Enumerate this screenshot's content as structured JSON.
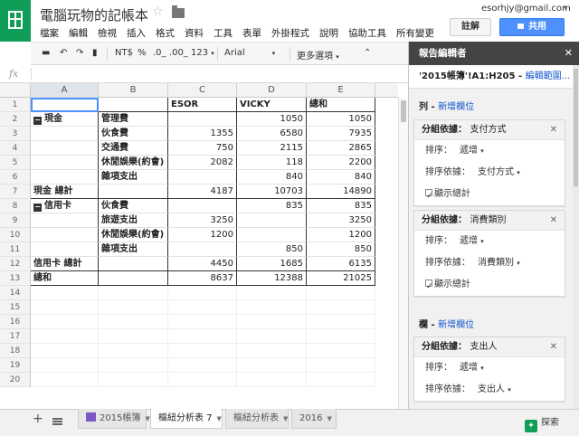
{
  "doc_title": "電腦玩物的記帳本",
  "user_email": "esorhjy@gmail.com",
  "menu": [
    "檔案",
    "編輯",
    "檢視",
    "插入",
    "格式",
    "資料",
    "工具",
    "表單",
    "外掛程式",
    "說明",
    "協助工具",
    "所有變更"
  ],
  "buttons": {
    "comment": "註解",
    "share": "共用"
  },
  "toolbar": {
    "currency": "NT$",
    "percent": "%",
    "dec_less": ".0_",
    "dec_more": ".00_",
    "format123": "123",
    "font": "Arial",
    "more": "更多選項"
  },
  "formula_label": "fx",
  "columns": [
    "A",
    "B",
    "C",
    "D",
    "E"
  ],
  "rows": [
    {
      "n": "1",
      "a": "",
      "b": "",
      "c": "ESOR",
      "d": "VICKY",
      "e": "總和"
    },
    {
      "n": "2",
      "a": "現金",
      "b": "管理費",
      "c": "",
      "d": "1050",
      "e": "1050"
    },
    {
      "n": "3",
      "a": "",
      "b": "伙食費",
      "c": "1355",
      "d": "6580",
      "e": "7935"
    },
    {
      "n": "4",
      "a": "",
      "b": "交通費",
      "c": "750",
      "d": "2115",
      "e": "2865"
    },
    {
      "n": "5",
      "a": "",
      "b": "休閒娛樂(約會)",
      "c": "2082",
      "d": "118",
      "e": "2200"
    },
    {
      "n": "6",
      "a": "",
      "b": "雜項支出",
      "c": "",
      "d": "840",
      "e": "840"
    },
    {
      "n": "7",
      "a": "現金 總計",
      "b": "",
      "c": "4187",
      "d": "10703",
      "e": "14890"
    },
    {
      "n": "8",
      "a": "信用卡",
      "b": "伙食費",
      "c": "",
      "d": "835",
      "e": "835"
    },
    {
      "n": "9",
      "a": "",
      "b": "旅遊支出",
      "c": "3250",
      "d": "",
      "e": "3250"
    },
    {
      "n": "10",
      "a": "",
      "b": "休閒娛樂(約會)",
      "c": "1200",
      "d": "",
      "e": "1200"
    },
    {
      "n": "11",
      "a": "",
      "b": "雜項支出",
      "c": "",
      "d": "850",
      "e": "850"
    },
    {
      "n": "12",
      "a": "信用卡 總計",
      "b": "",
      "c": "4450",
      "d": "1685",
      "e": "6135"
    },
    {
      "n": "13",
      "a": "總和",
      "b": "",
      "c": "8637",
      "d": "12388",
      "e": "21025"
    },
    {
      "n": "14",
      "a": "",
      "b": "",
      "c": "",
      "d": "",
      "e": ""
    },
    {
      "n": "15",
      "a": "",
      "b": "",
      "c": "",
      "d": "",
      "e": ""
    },
    {
      "n": "16",
      "a": "",
      "b": "",
      "c": "",
      "d": "",
      "e": ""
    },
    {
      "n": "17",
      "a": "",
      "b": "",
      "c": "",
      "d": "",
      "e": ""
    },
    {
      "n": "18",
      "a": "",
      "b": "",
      "c": "",
      "d": "",
      "e": ""
    },
    {
      "n": "19",
      "a": "",
      "b": "",
      "c": "",
      "d": "",
      "e": ""
    },
    {
      "n": "20",
      "a": "",
      "b": "",
      "c": "",
      "d": "",
      "e": ""
    }
  ],
  "panel": {
    "title": "報告編輯者",
    "range": "'2015帳簿'!A1:H205",
    "edit_range": "編輯範圍...",
    "rows_section": "列",
    "cols_section": "欄",
    "add_field": "新增欄位",
    "cards_rows": [
      {
        "group": "分組依據：",
        "field": "支付方式",
        "sort_label": "排序：",
        "sort_value": "遞增",
        "sortby_label": "排序依據：",
        "sortby_value": "支付方式",
        "totals": "顯示總計"
      },
      {
        "group": "分組依據：",
        "field": "消費類別",
        "sort_label": "排序：",
        "sort_value": "遞增",
        "sortby_label": "排序依據：",
        "sortby_value": "消費類別",
        "totals": "顯示總計"
      }
    ],
    "cards_cols": [
      {
        "group": "分組依據：",
        "field": "支出人",
        "sort_label": "排序：",
        "sort_value": "遞增",
        "sortby_label": "排序依據：",
        "sortby_value": "支出人"
      }
    ]
  },
  "tabs": [
    {
      "label": "2015帳簿",
      "active": false
    },
    {
      "label": "樞紐分析表 7",
      "active": true
    },
    {
      "label": "樞紐分析表",
      "active": false
    },
    {
      "label": "2016",
      "active": false
    }
  ],
  "explore": "探索"
}
